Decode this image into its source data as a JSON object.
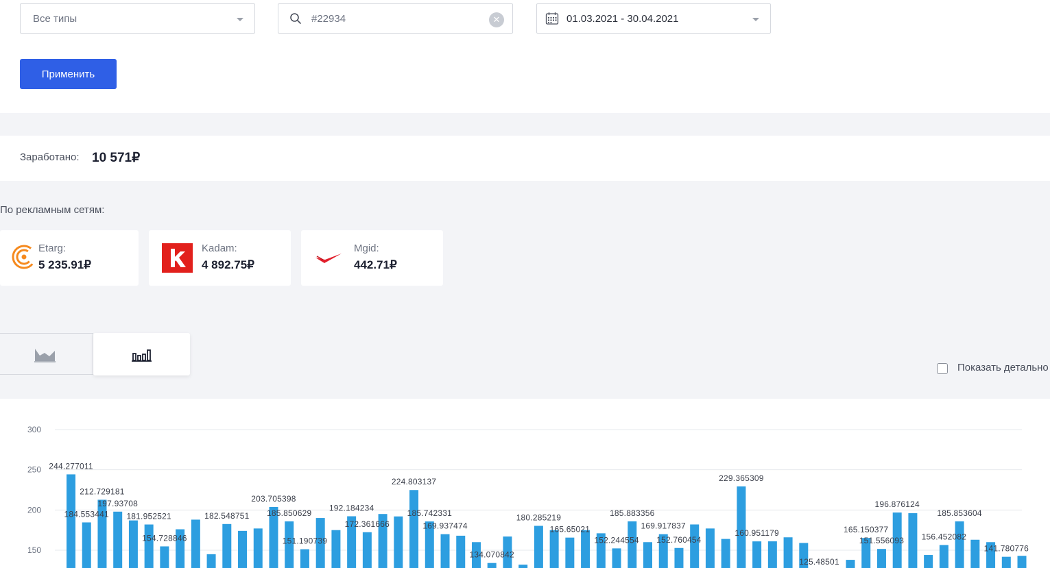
{
  "filters": {
    "type_select": "Все типы",
    "search_value": "#22934",
    "date_range": "01.03.2021 - 30.04.2021",
    "apply_label": "Применить"
  },
  "summary": {
    "earned_label": "Заработано:",
    "earned_value": "10 571₽"
  },
  "networks": {
    "title": "По рекламным сетям:",
    "items": [
      {
        "name": "Etarg:",
        "value": "5 235.91₽",
        "icon": "etarg-logo"
      },
      {
        "name": "Kadam:",
        "value": "4 892.75₽",
        "icon": "kadam-logo"
      },
      {
        "name": "Mgid:",
        "value": "442.71₽",
        "icon": "mgid-logo"
      }
    ]
  },
  "view_toggle": {
    "options": [
      {
        "icon": "area-chart-icon",
        "active": false
      },
      {
        "icon": "bar-chart-icon",
        "active": true
      }
    ]
  },
  "details_checkbox": {
    "label": "Показать детально",
    "checked": false
  },
  "colors": {
    "accent": "#2f5fe6",
    "bar": "#2d9ee0",
    "panel_bg": "#f3f4f7"
  },
  "chart_data": {
    "type": "bar",
    "ylim": [
      0,
      300
    ],
    "yticks": [
      150,
      200,
      250,
      300
    ],
    "grid": true,
    "values": [
      244.277011,
      184.553441,
      212.729181,
      197.93708,
      187,
      181.952521,
      154.728846,
      176,
      188,
      145,
      182.548751,
      174,
      177,
      203.705398,
      185.850629,
      151.190739,
      190,
      175,
      192.184234,
      172.361666,
      195,
      192,
      224.803137,
      185.742331,
      169.937474,
      168,
      160,
      134.070842,
      167,
      132,
      180.285219,
      175,
      165.65021,
      175,
      171,
      152.244554,
      185.883356,
      160,
      169.917837,
      152.760454,
      182,
      177,
      164,
      229.365309,
      160.951179,
      161,
      166,
      159,
      125.48501,
      120,
      138,
      165.150377,
      151.556093,
      196.876124,
      196,
      144,
      156.452082,
      185.853604,
      163,
      160,
      141.780776,
      143
    ],
    "data_labels": [
      {
        "i": 0,
        "text": "244.277011"
      },
      {
        "i": 1,
        "text": "184.553441"
      },
      {
        "i": 2,
        "text": "212.729181"
      },
      {
        "i": 3,
        "text": "197.93708"
      },
      {
        "i": 5,
        "text": "181.952521"
      },
      {
        "i": 6,
        "text": "154.728846"
      },
      {
        "i": 10,
        "text": "182.548751"
      },
      {
        "i": 13,
        "text": "203.705398"
      },
      {
        "i": 14,
        "text": "185.850629"
      },
      {
        "i": 15,
        "text": "151.190739"
      },
      {
        "i": 18,
        "text": "192.184234"
      },
      {
        "i": 19,
        "text": "172.361666"
      },
      {
        "i": 22,
        "text": "224.803137"
      },
      {
        "i": 23,
        "text": "185.742331"
      },
      {
        "i": 24,
        "text": "169.937474"
      },
      {
        "i": 27,
        "text": "134.070842"
      },
      {
        "i": 30,
        "text": "180.285219"
      },
      {
        "i": 32,
        "text": "165.65021"
      },
      {
        "i": 35,
        "text": "152.244554"
      },
      {
        "i": 36,
        "text": "185.883356"
      },
      {
        "i": 38,
        "text": "169.917837"
      },
      {
        "i": 39,
        "text": "152.760454"
      },
      {
        "i": 43,
        "text": "229.365309"
      },
      {
        "i": 44,
        "text": "160.951179"
      },
      {
        "i": 48,
        "text": "125.48501"
      },
      {
        "i": 51,
        "text": "165.150377"
      },
      {
        "i": 52,
        "text": "151.556093"
      },
      {
        "i": 53,
        "text": "196.876124"
      },
      {
        "i": 56,
        "text": "156.452082"
      },
      {
        "i": 57,
        "text": "185.853604"
      },
      {
        "i": 60,
        "text": "141.780776"
      }
    ]
  }
}
